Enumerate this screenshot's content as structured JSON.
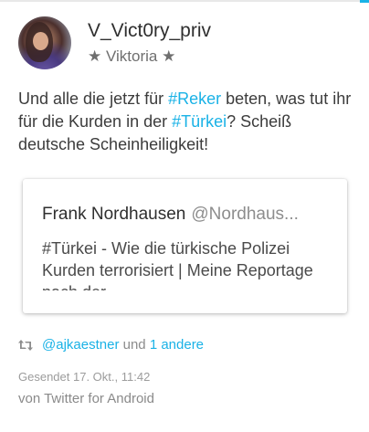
{
  "colors": {
    "accent": "#1ab2e6",
    "text": "#3c3c3c",
    "muted": "#8c8c8c"
  },
  "header": {
    "username": "V_Vict0ry_priv",
    "display_name": "★ Viktoria ★"
  },
  "tweet": {
    "text_parts": [
      "Und alle die jetzt für ",
      "#Reker",
      " beten, was tut ihr für die Kurden in der ",
      "#Türkei",
      "? Scheiß deutsche Scheinheiligkeit!"
    ]
  },
  "quoted": {
    "author": "Frank Nordhausen",
    "handle": "@Nordhaus...",
    "text": "#Türkei - Wie die türkische Polizei Kurden terrorisiert | Meine Reportage nach der"
  },
  "retweets": {
    "icon": "retweet-icon",
    "user": "@ajkaestner",
    "connector": "und",
    "others": "1 andere"
  },
  "meta": {
    "sent": "Gesendet 17. Okt., 11:42",
    "via": "von Twitter for Android"
  }
}
